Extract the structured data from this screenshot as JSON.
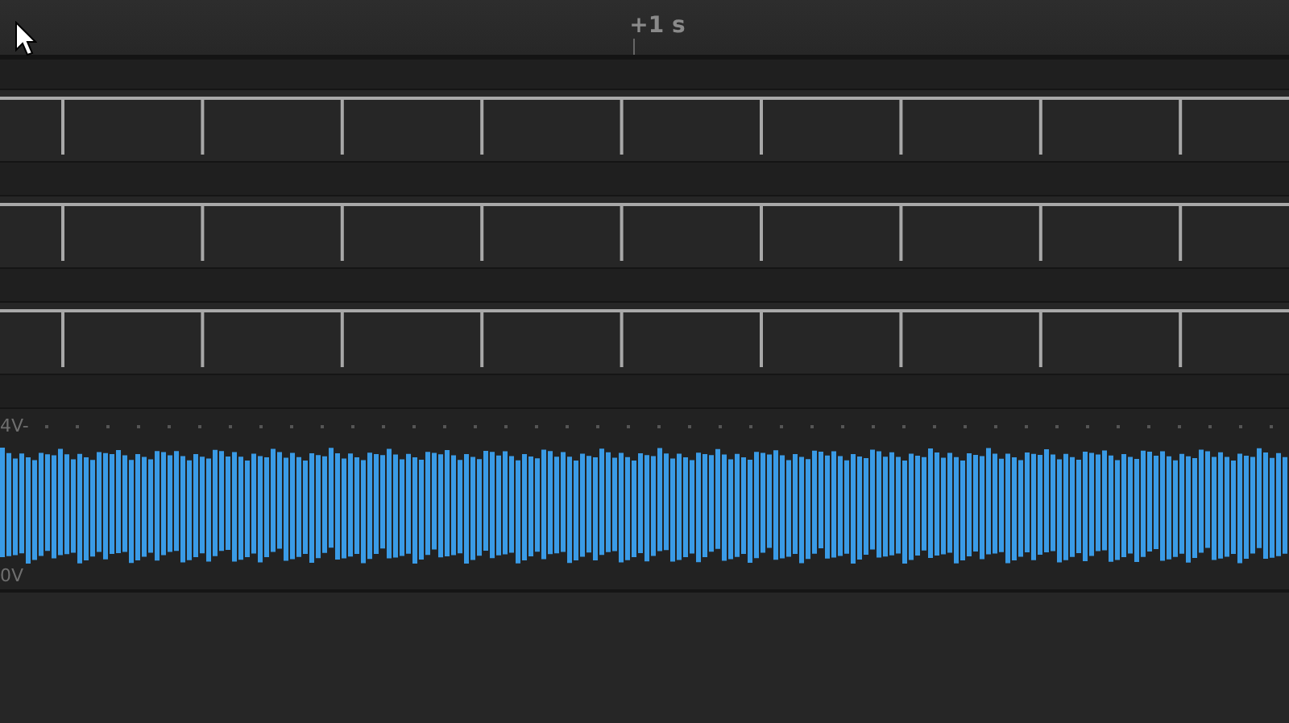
{
  "timeline": {
    "marker": "+1 s"
  },
  "channels": [
    {
      "kind": "digital"
    },
    {
      "kind": "digital"
    },
    {
      "kind": "digital"
    },
    {
      "kind": "analog",
      "scale_top": "4V-",
      "scale_bottom": "0V"
    }
  ]
}
